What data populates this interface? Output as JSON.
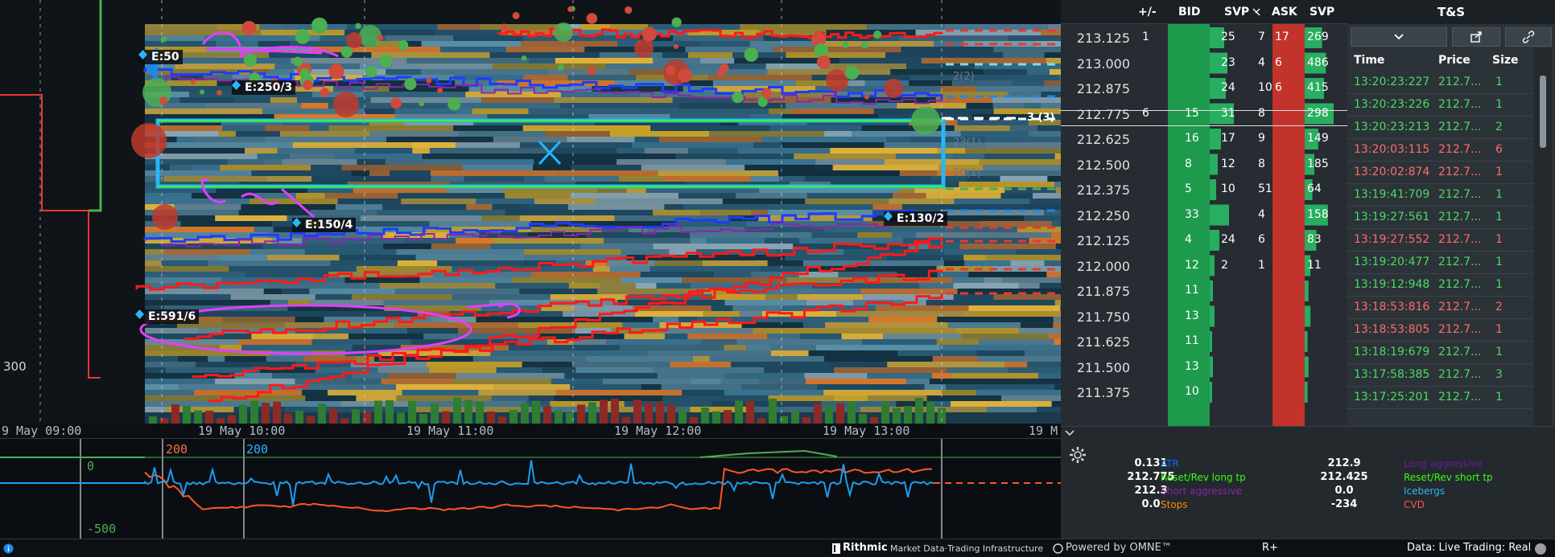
{
  "chart": {
    "time_labels": [
      "9 May 09:00",
      "19 May 10:00",
      "19 May 11:00",
      "19 May 12:00",
      "19 May 13:00",
      "19 M"
    ],
    "side_number": "300",
    "entry_labels": [
      "E:50",
      "E:250/3",
      "E:150/4",
      "E:130/2",
      "E:591/6"
    ],
    "level_badge": "3 (3)",
    "ghost_labels": [
      "2(2)",
      "23(1)",
      "20(1)"
    ],
    "colors": {
      "background": "#0f1419",
      "bid_green": "#1e9a4d",
      "ask_red": "#c2332b",
      "stop_red": "#e53935",
      "iceberg_blue": "#1e88e5",
      "annotation_magenta": "#e040fb",
      "cyan_box": "#29b6f6"
    }
  },
  "indicator": {
    "labels": {
      "red_top": "200",
      "blue_top": "200",
      "zero": "0",
      "bottom": "-500"
    }
  },
  "dom": {
    "headers": [
      "+/-",
      "BID",
      "SVP",
      "ASK",
      "SVP"
    ],
    "prices": [
      "213.125",
      "213.000",
      "212.875",
      "212.775",
      "212.625",
      "212.500",
      "212.375",
      "212.250",
      "212.125",
      "212.000",
      "211.875",
      "211.750",
      "211.625",
      "211.500",
      "211.375"
    ],
    "current_price": "212.775",
    "plusminus": [
      "1",
      "",
      "",
      "6",
      "",
      "",
      "",
      "",
      "",
      "",
      "",
      "",
      "",
      "",
      ""
    ],
    "bid": [
      "",
      "",
      "",
      "15",
      "16",
      "8",
      "5",
      "33",
      "4",
      "12",
      "11",
      "13",
      "11",
      "13",
      "10"
    ],
    "svp_bid": [
      "25",
      "23",
      "24",
      "31",
      "17",
      "12",
      "10",
      "",
      "24",
      "2",
      "",
      "",
      "",
      "",
      ""
    ],
    "svp_mid": [
      "7",
      "4",
      "10",
      "8",
      "9",
      "8",
      "51",
      "4",
      "6",
      "1",
      "",
      "",
      "",
      "",
      ""
    ],
    "ask": [
      "17",
      "6",
      "6",
      "",
      "",
      "",
      "",
      "",
      "",
      "",
      "",
      "",
      "",
      "",
      ""
    ],
    "svp_ask": [
      "269",
      "486",
      "415",
      "298",
      "149",
      "185",
      "64",
      "158",
      "83",
      "11",
      "",
      "",
      "",
      "",
      ""
    ]
  },
  "ts": {
    "title": "T&S",
    "headers": [
      "Time",
      "Price",
      "Size"
    ],
    "rows": [
      {
        "time": "13:20:23:227",
        "price": "212.7...",
        "size": "1",
        "side": "buy"
      },
      {
        "time": "13:20:23:226",
        "price": "212.7...",
        "size": "1",
        "side": "buy"
      },
      {
        "time": "13:20:23:213",
        "price": "212.7...",
        "size": "2",
        "side": "buy"
      },
      {
        "time": "13:20:03:115",
        "price": "212.7...",
        "size": "6",
        "side": "sell"
      },
      {
        "time": "13:20:02:874",
        "price": "212.7...",
        "size": "1",
        "side": "sell"
      },
      {
        "time": "13:19:41:709",
        "price": "212.7...",
        "size": "1",
        "side": "buy"
      },
      {
        "time": "13:19:27:561",
        "price": "212.7...",
        "size": "1",
        "side": "buy"
      },
      {
        "time": "13:19:27:552",
        "price": "212.7...",
        "size": "1",
        "side": "sell"
      },
      {
        "time": "13:19:20:477",
        "price": "212.7...",
        "size": "1",
        "side": "buy"
      },
      {
        "time": "13:19:12:948",
        "price": "212.7...",
        "size": "1",
        "side": "buy"
      },
      {
        "time": "13:18:53:816",
        "price": "212.7...",
        "size": "2",
        "side": "sell"
      },
      {
        "time": "13:18:53:805",
        "price": "212.7...",
        "size": "1",
        "side": "sell"
      },
      {
        "time": "13:18:19:679",
        "price": "212.7...",
        "size": "1",
        "side": "buy"
      },
      {
        "time": "13:17:58:385",
        "price": "212.7...",
        "size": "3",
        "side": "buy"
      },
      {
        "time": "13:17:25:201",
        "price": "212.7...",
        "size": "1",
        "side": "buy"
      }
    ],
    "colors": {
      "buy": "#4cd964",
      "sell": "#ff6b6b"
    }
  },
  "info": {
    "left_values": [
      "0.131",
      "212.775",
      "212.3",
      "0.0"
    ],
    "right_values": [
      "212.9",
      "212.425",
      "0.0",
      "-234"
    ],
    "legend_left": [
      {
        "label": "ATR",
        "color": "#1565ff"
      },
      {
        "label": "Reset/Rev long tp",
        "color": "#39ff14"
      },
      {
        "label": "Short aggressive",
        "color": "#8e24aa"
      },
      {
        "label": "Stops",
        "color": "#ff8a00"
      }
    ],
    "legend_right": [
      {
        "label": "Long aggressive",
        "color": "#6a1b9a"
      },
      {
        "label": "Reset/Rev short tp",
        "color": "#39ff14"
      },
      {
        "label": "Icebergs",
        "color": "#29b6f6"
      },
      {
        "label": "CVD",
        "color": "#ff5252"
      }
    ]
  },
  "status": {
    "brand": "Rithmic",
    "brand_tagline": "Market Data·Trading Infrastructure",
    "powered": "Powered by OMNE™",
    "rplus": "R+",
    "data": "Data: Live",
    "trading": "Trading: Real"
  }
}
